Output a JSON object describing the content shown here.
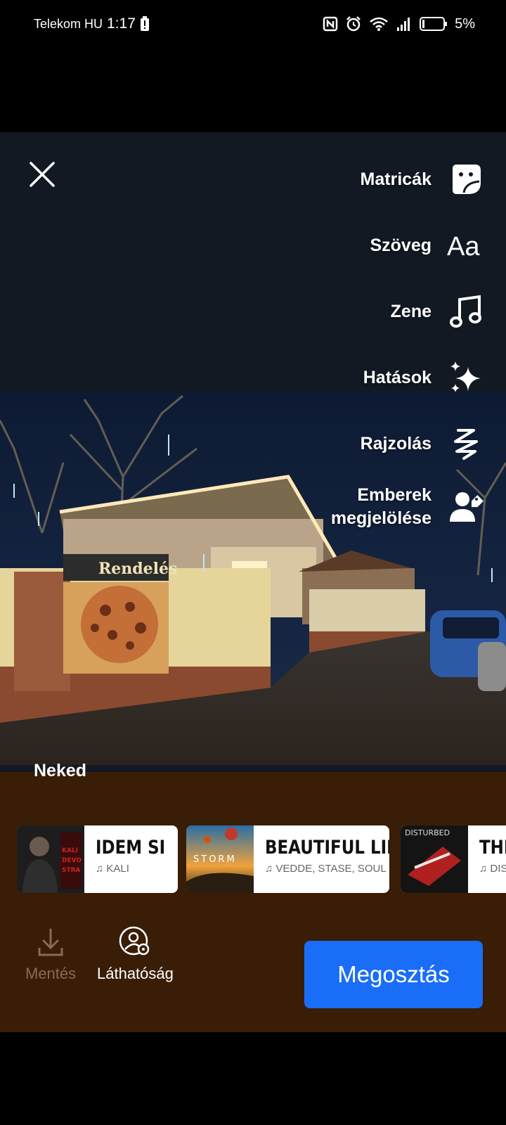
{
  "status_bar": {
    "carrier": "Telekom HU",
    "time": "1:17",
    "battery": "5%"
  },
  "tools": [
    {
      "label": "Matricák",
      "icon": "sticker-icon"
    },
    {
      "label": "Szöveg",
      "icon": "text-icon"
    },
    {
      "label": "Zene",
      "icon": "music-note-icon"
    },
    {
      "label": "Hatások",
      "icon": "sparkles-icon"
    },
    {
      "label": "Rajzolás",
      "icon": "scribble-icon"
    },
    {
      "label": "Emberek\nmegjelölése",
      "icon": "tag-people-icon"
    }
  ],
  "music": {
    "section_label": "Neked",
    "tracks": [
      {
        "title": "IDEM SI",
        "artist": "KALI"
      },
      {
        "title": "BEAUTIFUL LIF",
        "artist": "VEDDE, STASE, SOUL PA"
      },
      {
        "title": "THI",
        "artist": "DIS"
      }
    ],
    "cover_texts": {
      "storm": "STORM",
      "disturbed": "DISTURBED"
    }
  },
  "photo_sign": "Rendelés",
  "actions": {
    "save": "Mentés",
    "visibility": "Láthatóság",
    "share": "Megosztás"
  },
  "colors": {
    "editor_bg": "#121923",
    "panel_bg": "#3a1d06",
    "share_button": "#1a6df6"
  }
}
